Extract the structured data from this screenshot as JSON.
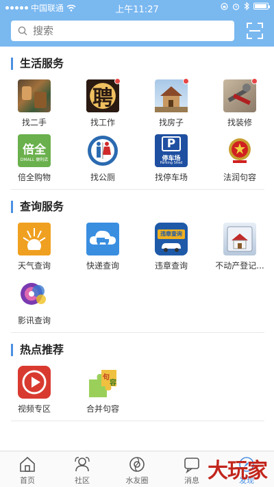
{
  "status": {
    "carrier": "中国联通",
    "time": "上午11:27"
  },
  "search": {
    "placeholder": "搜索"
  },
  "sections": [
    {
      "title": "生活服务",
      "items": [
        {
          "label": "找二手",
          "icon": "market-icon",
          "badge": false
        },
        {
          "label": "找工作",
          "icon": "hiring-icon",
          "badge": true
        },
        {
          "label": "找房子",
          "icon": "house-icon",
          "badge": true
        },
        {
          "label": "找装修",
          "icon": "tools-icon",
          "badge": true
        },
        {
          "label": "倍全购物",
          "icon": "beiquan-icon",
          "badge": false
        },
        {
          "label": "找公厕",
          "icon": "toilet-icon",
          "badge": false
        },
        {
          "label": "找停车场",
          "icon": "parking-icon",
          "badge": false
        },
        {
          "label": "法润句容",
          "icon": "court-emblem-icon",
          "badge": false
        }
      ]
    },
    {
      "title": "查询服务",
      "items": [
        {
          "label": "天气查询",
          "icon": "weather-icon",
          "badge": false
        },
        {
          "label": "快递查询",
          "icon": "delivery-icon",
          "badge": false
        },
        {
          "label": "违章查询",
          "icon": "traffic-violation-icon",
          "badge": false
        },
        {
          "label": "不动产登记...",
          "icon": "real-estate-icon",
          "badge": false
        },
        {
          "label": "影讯查询",
          "icon": "film-icon",
          "badge": false
        }
      ]
    },
    {
      "title": "热点推荐",
      "items": [
        {
          "label": "视频专区",
          "icon": "video-play-icon",
          "badge": false
        },
        {
          "label": "合并句容",
          "icon": "puzzle-icon",
          "badge": false
        }
      ]
    }
  ],
  "icon_text": {
    "hiring": "聘",
    "beiquan": "倍全",
    "beiquan_sub": "DMALL 便利店",
    "parking_p": "P",
    "parking_cn": "停车场",
    "parking_en": "Parking Sited",
    "violation": "违章查询",
    "puzzle_a": "句",
    "puzzle_b": "容"
  },
  "tabs": [
    {
      "label": "首页",
      "icon": "home-icon",
      "active": false
    },
    {
      "label": "社区",
      "icon": "community-icon",
      "active": false
    },
    {
      "label": "水友圈",
      "icon": "circle-icon",
      "active": false
    },
    {
      "label": "消息",
      "icon": "message-icon",
      "active": false
    },
    {
      "label": "发现",
      "icon": "discover-icon",
      "active": true
    }
  ],
  "watermark": "大玩家",
  "colors": {
    "header": "#7ab8f0",
    "accent": "#4a90e2",
    "badge": "#e64545"
  }
}
